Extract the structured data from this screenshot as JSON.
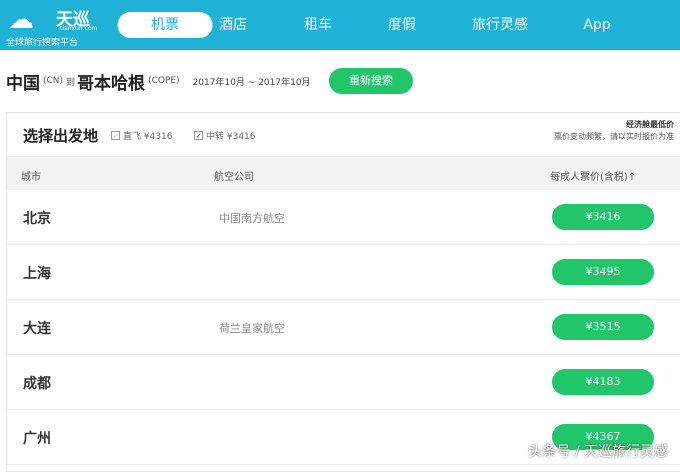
{
  "logo": {
    "name": "天巡",
    "domain": "tianxun.com",
    "slogan": "全球旅行搜索平台"
  },
  "nav": [
    {
      "label": "机票",
      "active": true
    },
    {
      "label": "酒店"
    },
    {
      "label": "租车"
    },
    {
      "label": "度假"
    },
    {
      "label": "旅行灵感"
    },
    {
      "label": "App"
    }
  ],
  "route": {
    "from": "中国",
    "from_code": "(CN)",
    "to_word": "到",
    "to": "哥本哈根",
    "to_code": "(COPE)",
    "dates": "2017年10月 ~ 2017年10月",
    "research": "重新搜索"
  },
  "card": {
    "title": "选择出发地",
    "direct": "直飞 ¥4316",
    "transfer": "中转 ¥3416",
    "note_title": "经济舱最低价",
    "note_sub": "票价变动频繁，请以实时报价为准"
  },
  "columns": {
    "city": "城市",
    "airline": "航空公司",
    "price": "每成人票价(含税)↑"
  },
  "rows": [
    {
      "city": "北京",
      "airline": "中国南方航空",
      "price": "¥3416"
    },
    {
      "city": "上海",
      "airline": "",
      "price": "¥3495"
    },
    {
      "city": "大连",
      "airline": "荷兰皇家航空",
      "price": "¥3515"
    },
    {
      "city": "成都",
      "airline": "",
      "price": "¥4183"
    },
    {
      "city": "广州",
      "airline": "",
      "price": "¥4367"
    }
  ],
  "watermark": "头条号 / 天巡旅行灵感"
}
